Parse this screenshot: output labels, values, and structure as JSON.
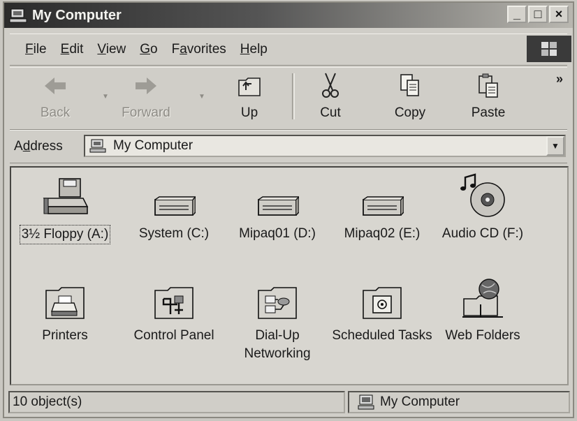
{
  "window": {
    "title": "My Computer"
  },
  "title_buttons": [
    "_",
    "□",
    "×"
  ],
  "menu": [
    {
      "pre": "",
      "ul": "F",
      "post": "ile"
    },
    {
      "pre": "",
      "ul": "E",
      "post": "dit"
    },
    {
      "pre": "",
      "ul": "V",
      "post": "iew"
    },
    {
      "pre": "",
      "ul": "G",
      "post": "o"
    },
    {
      "pre": "F",
      "ul": "a",
      "post": "vorites"
    },
    {
      "pre": "",
      "ul": "H",
      "post": "elp"
    }
  ],
  "toolbar": {
    "back": "Back",
    "forward": "Forward",
    "up": "Up",
    "cut": "Cut",
    "copy": "Copy",
    "paste": "Paste",
    "more": "»"
  },
  "address": {
    "label_pre": "A",
    "label_ul": "d",
    "label_post": "dress",
    "value": "My Computer"
  },
  "items": [
    {
      "name": "3½ Floppy (A:)",
      "icon": "floppy-drive-icon"
    },
    {
      "name": "System (C:)",
      "icon": "hard-drive-icon"
    },
    {
      "name": "Mipaq01 (D:)",
      "icon": "hard-drive-icon"
    },
    {
      "name": "Mipaq02 (E:)",
      "icon": "hard-drive-icon"
    },
    {
      "name": "Audio CD (F:)",
      "icon": "audio-cd-icon"
    },
    {
      "name": "Printers",
      "icon": "printers-folder-icon"
    },
    {
      "name": "Control Panel",
      "icon": "control-panel-folder-icon"
    },
    {
      "name": "Dial-Up Networking",
      "icon": "dialup-folder-icon"
    },
    {
      "name": "Scheduled Tasks",
      "icon": "scheduled-tasks-folder-icon"
    },
    {
      "name": "Web Folders",
      "icon": "web-folders-icon"
    }
  ],
  "status": {
    "count": "10 object(s)",
    "location": "My Computer"
  }
}
